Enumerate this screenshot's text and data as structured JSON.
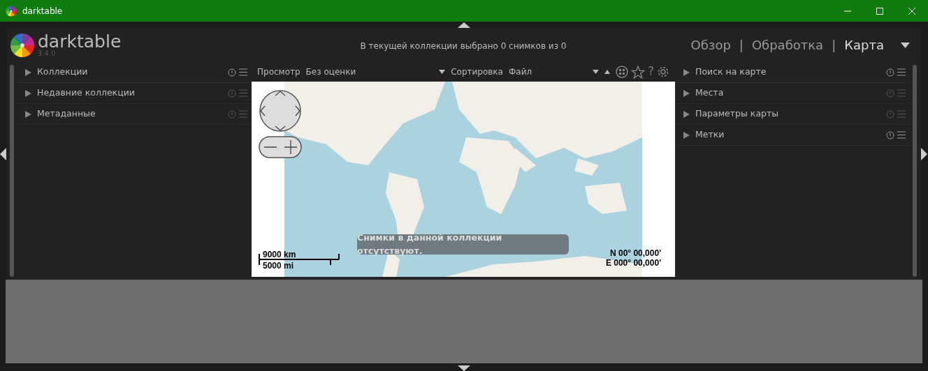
{
  "window": {
    "title": "darktable"
  },
  "logo": {
    "name": "darktable",
    "version": "3.4.0"
  },
  "status": "В текущей коллекции выбрано 0 снимков из 0",
  "views": [
    {
      "label": "Обзор",
      "selected": false
    },
    {
      "label": "Обработка",
      "selected": false
    },
    {
      "label": "Карта",
      "selected": true
    }
  ],
  "view_separators": [
    "|",
    "|"
  ],
  "left_modules": [
    {
      "label": "Коллекции",
      "expanded": false,
      "icons_enabled": true
    },
    {
      "label": "Недавние коллекции",
      "expanded": false,
      "icons_enabled": false
    },
    {
      "label": "Метаданные",
      "expanded": false,
      "icons_enabled": false
    }
  ],
  "toolbar": {
    "filter_label": "Просмотр",
    "filter_value": "Без оценки",
    "sort_label": "Сортировка",
    "sort_value": "Файл",
    "sort_ascending": true,
    "help": "?"
  },
  "map": {
    "message": "Снимки в данной коллекции отсутствуют.",
    "scale_metric": "9000 km",
    "scale_imperial": "5000 mi",
    "latitude": "N 00° 00,000'",
    "longitude": "E 000° 00,000'"
  },
  "right_modules": [
    {
      "label": "Поиск на карте",
      "expanded": false,
      "icons_enabled": true
    },
    {
      "label": "Места",
      "expanded": false,
      "icons_enabled": false
    },
    {
      "label": "Параметры карты",
      "expanded": false,
      "icons_enabled": false
    },
    {
      "label": "Метки",
      "expanded": false,
      "icons_enabled": true
    }
  ]
}
